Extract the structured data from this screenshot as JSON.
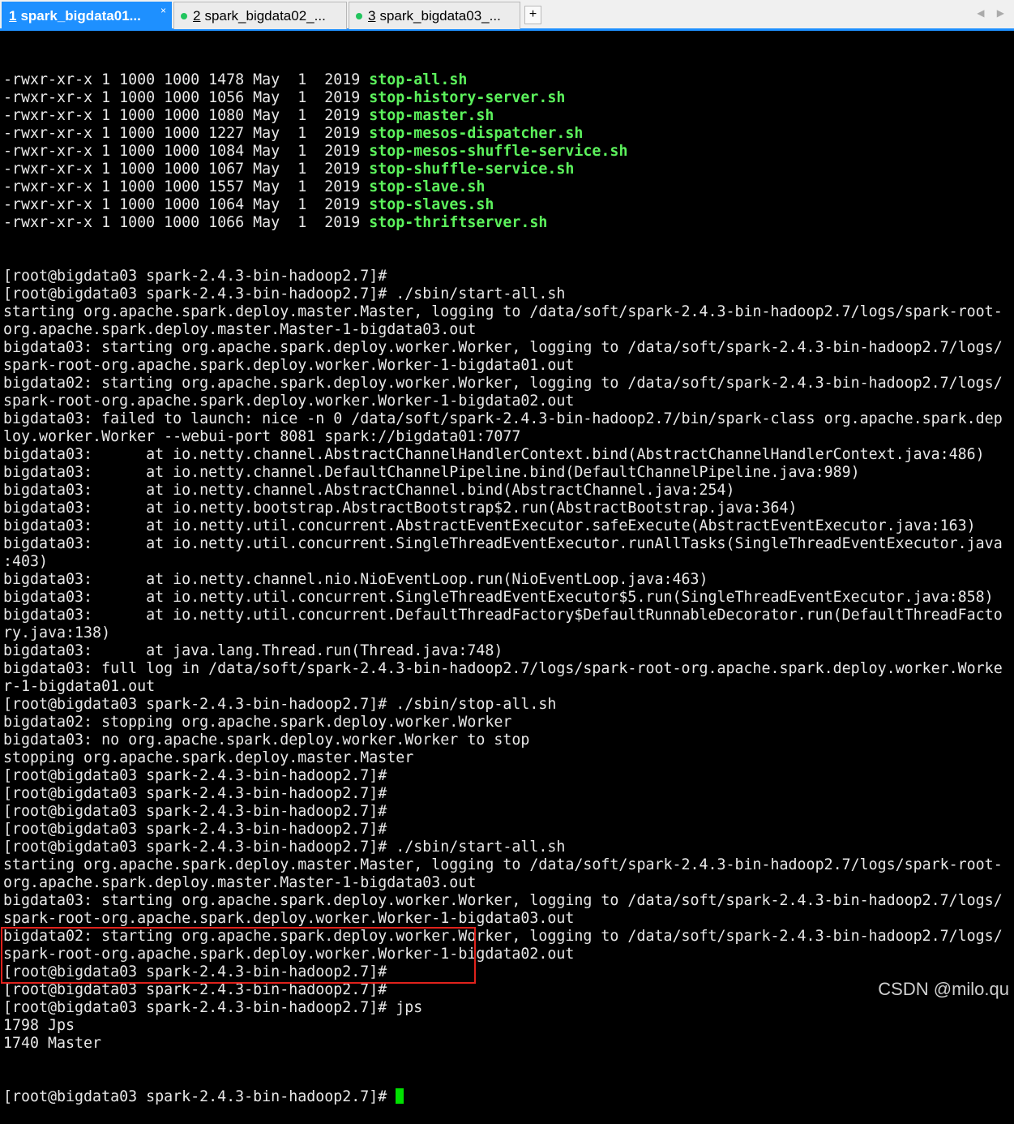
{
  "tabs": [
    {
      "num": "1",
      "label": "spark_bigdata01...",
      "close": "×"
    },
    {
      "num": "2",
      "label": "spark_bigdata02_..."
    },
    {
      "num": "3",
      "label": "spark_bigdata03_..."
    }
  ],
  "add_tab": "+",
  "nav_arrows": "◀ ▶",
  "colors": {
    "executable_green": "#5cf25c",
    "tab_active": "#1e90ff",
    "highlight_border": "#e0221c",
    "cursor": "#00e000"
  },
  "files": [
    {
      "prefix": "-rwxr-xr-x 1 1000 1000 1478 May  1  2019 ",
      "name": "stop-all.sh"
    },
    {
      "prefix": "-rwxr-xr-x 1 1000 1000 1056 May  1  2019 ",
      "name": "stop-history-server.sh"
    },
    {
      "prefix": "-rwxr-xr-x 1 1000 1000 1080 May  1  2019 ",
      "name": "stop-master.sh"
    },
    {
      "prefix": "-rwxr-xr-x 1 1000 1000 1227 May  1  2019 ",
      "name": "stop-mesos-dispatcher.sh"
    },
    {
      "prefix": "-rwxr-xr-x 1 1000 1000 1084 May  1  2019 ",
      "name": "stop-mesos-shuffle-service.sh"
    },
    {
      "prefix": "-rwxr-xr-x 1 1000 1000 1067 May  1  2019 ",
      "name": "stop-shuffle-service.sh"
    },
    {
      "prefix": "-rwxr-xr-x 1 1000 1000 1557 May  1  2019 ",
      "name": "stop-slave.sh"
    },
    {
      "prefix": "-rwxr-xr-x 1 1000 1000 1064 May  1  2019 ",
      "name": "stop-slaves.sh"
    },
    {
      "prefix": "-rwxr-xr-x 1 1000 1000 1066 May  1  2019 ",
      "name": "stop-thriftserver.sh"
    }
  ],
  "lines": [
    "[root@bigdata03 spark-2.4.3-bin-hadoop2.7]#",
    "[root@bigdata03 spark-2.4.3-bin-hadoop2.7]# ./sbin/start-all.sh",
    "starting org.apache.spark.deploy.master.Master, logging to /data/soft/spark-2.4.3-bin-hadoop2.7/logs/spark-root-",
    "org.apache.spark.deploy.master.Master-1-bigdata03.out",
    "bigdata03: starting org.apache.spark.deploy.worker.Worker, logging to /data/soft/spark-2.4.3-bin-hadoop2.7/logs/",
    "spark-root-org.apache.spark.deploy.worker.Worker-1-bigdata01.out",
    "bigdata02: starting org.apache.spark.deploy.worker.Worker, logging to /data/soft/spark-2.4.3-bin-hadoop2.7/logs/",
    "spark-root-org.apache.spark.deploy.worker.Worker-1-bigdata02.out",
    "bigdata03: failed to launch: nice -n 0 /data/soft/spark-2.4.3-bin-hadoop2.7/bin/spark-class org.apache.spark.dep",
    "loy.worker.Worker --webui-port 8081 spark://bigdata01:7077",
    "bigdata03:      at io.netty.channel.AbstractChannelHandlerContext.bind(AbstractChannelHandlerContext.java:486)",
    "bigdata03:      at io.netty.channel.DefaultChannelPipeline.bind(DefaultChannelPipeline.java:989)",
    "bigdata03:      at io.netty.channel.AbstractChannel.bind(AbstractChannel.java:254)",
    "bigdata03:      at io.netty.bootstrap.AbstractBootstrap$2.run(AbstractBootstrap.java:364)",
    "bigdata03:      at io.netty.util.concurrent.AbstractEventExecutor.safeExecute(AbstractEventExecutor.java:163)",
    "bigdata03:      at io.netty.util.concurrent.SingleThreadEventExecutor.runAllTasks(SingleThreadEventExecutor.java",
    ":403)",
    "bigdata03:      at io.netty.channel.nio.NioEventLoop.run(NioEventLoop.java:463)",
    "bigdata03:      at io.netty.util.concurrent.SingleThreadEventExecutor$5.run(SingleThreadEventExecutor.java:858)",
    "bigdata03:      at io.netty.util.concurrent.DefaultThreadFactory$DefaultRunnableDecorator.run(DefaultThreadFacto",
    "ry.java:138)",
    "bigdata03:      at java.lang.Thread.run(Thread.java:748)",
    "bigdata03: full log in /data/soft/spark-2.4.3-bin-hadoop2.7/logs/spark-root-org.apache.spark.deploy.worker.Worke",
    "r-1-bigdata01.out",
    "[root@bigdata03 spark-2.4.3-bin-hadoop2.7]# ./sbin/stop-all.sh",
    "bigdata02: stopping org.apache.spark.deploy.worker.Worker",
    "bigdata03: no org.apache.spark.deploy.worker.Worker to stop",
    "stopping org.apache.spark.deploy.master.Master",
    "[root@bigdata03 spark-2.4.3-bin-hadoop2.7]#",
    "[root@bigdata03 spark-2.4.3-bin-hadoop2.7]#",
    "[root@bigdata03 spark-2.4.3-bin-hadoop2.7]#",
    "[root@bigdata03 spark-2.4.3-bin-hadoop2.7]#",
    "[root@bigdata03 spark-2.4.3-bin-hadoop2.7]# ./sbin/start-all.sh",
    "starting org.apache.spark.deploy.master.Master, logging to /data/soft/spark-2.4.3-bin-hadoop2.7/logs/spark-root-",
    "org.apache.spark.deploy.master.Master-1-bigdata03.out",
    "bigdata03: starting org.apache.spark.deploy.worker.Worker, logging to /data/soft/spark-2.4.3-bin-hadoop2.7/logs/",
    "spark-root-org.apache.spark.deploy.worker.Worker-1-bigdata03.out",
    "bigdata02: starting org.apache.spark.deploy.worker.Worker, logging to /data/soft/spark-2.4.3-bin-hadoop2.7/logs/",
    "spark-root-org.apache.spark.deploy.worker.Worker-1-bigdata02.out",
    "[root@bigdata03 spark-2.4.3-bin-hadoop2.7]#",
    "[root@bigdata03 spark-2.4.3-bin-hadoop2.7]#",
    "[root@bigdata03 spark-2.4.3-bin-hadoop2.7]# jps",
    "1798 Jps",
    "1740 Master"
  ],
  "prompt": "[root@bigdata03 spark-2.4.3-bin-hadoop2.7]# ",
  "watermark": "CSDN @milo.qu"
}
